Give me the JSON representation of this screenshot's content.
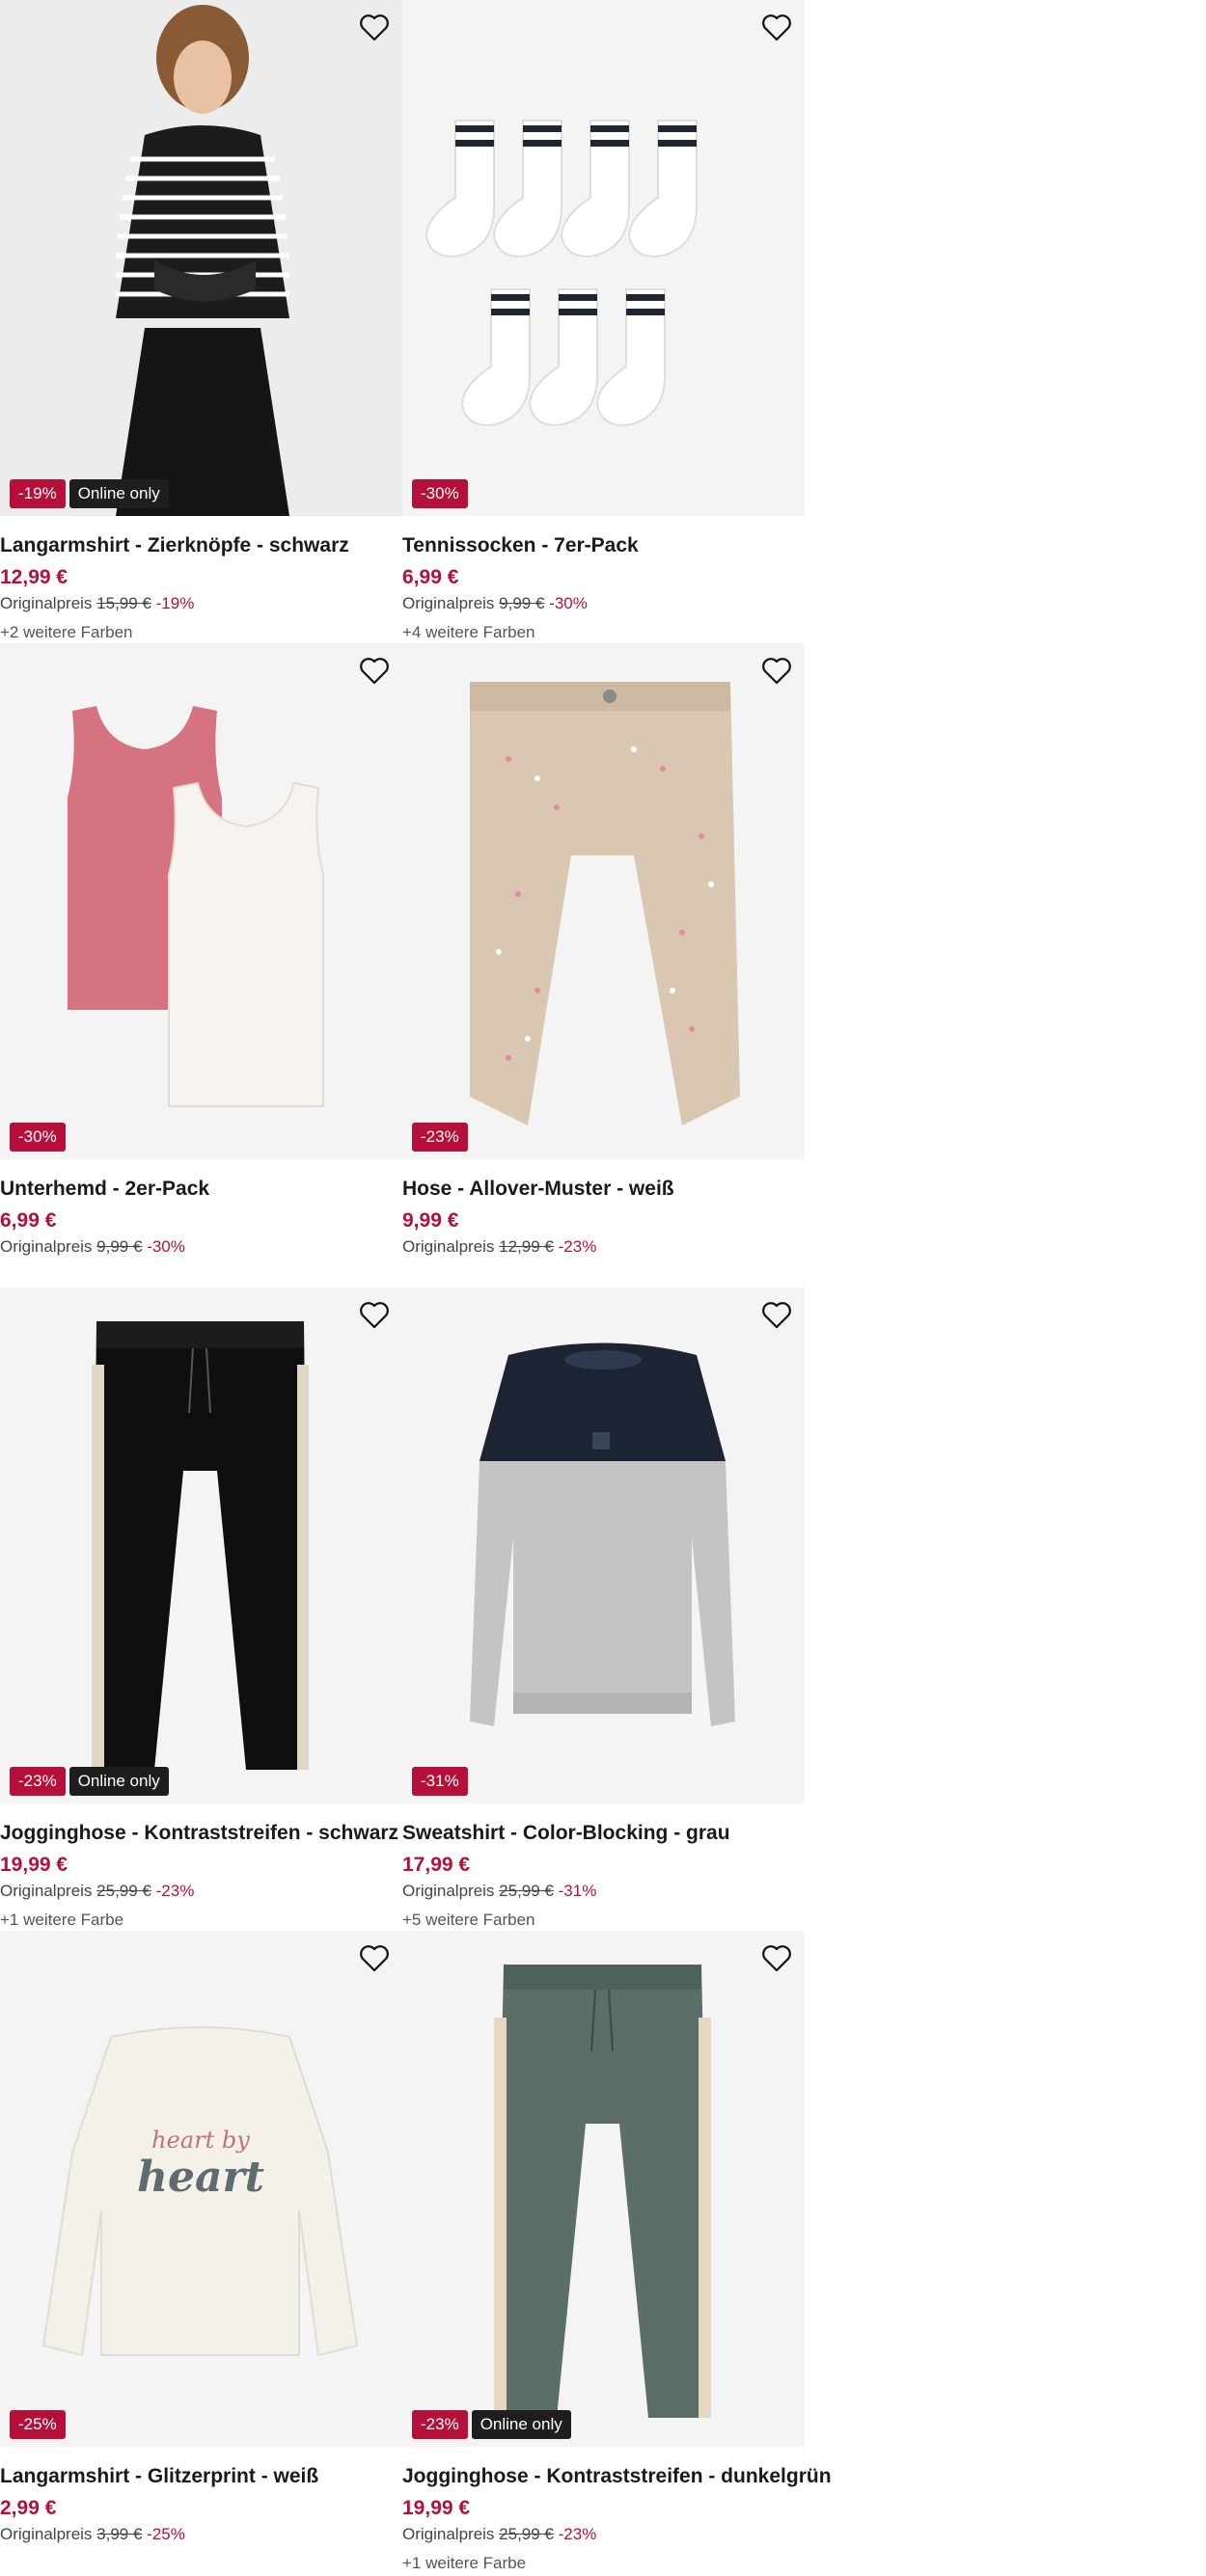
{
  "colors": {
    "sale": "#b5103a",
    "online": "#1e1e1e",
    "price": "#b5103a"
  },
  "products": [
    {
      "title": "Langarmshirt - Zierknöpfe - schwarz",
      "price": "12,99 €",
      "orig_label": "Originalpreis",
      "orig_price": "15,99 €",
      "discount": "-19%",
      "badge_sale": "-19%",
      "badge_online": "Online only",
      "more_colors": "+2 weitere Farben",
      "image_icon": "striped-longsleeve-model",
      "fav_icon": "heart-outline-icon"
    },
    {
      "title": "Tennissocken - 7er-Pack",
      "price": "6,99 €",
      "orig_label": "Originalpreis",
      "orig_price": "9,99 €",
      "discount": "-30%",
      "badge_sale": "-30%",
      "badge_online": "",
      "more_colors": "+4 weitere Farben",
      "image_icon": "white-tennis-socks",
      "fav_icon": "heart-outline-icon"
    },
    {
      "title": "Unterhemd - 2er-Pack",
      "price": "6,99 €",
      "orig_label": "Originalpreis",
      "orig_price": "9,99 €",
      "discount": "-30%",
      "badge_sale": "-30%",
      "badge_online": "",
      "more_colors": "",
      "image_icon": "tank-tops-pink-white",
      "fav_icon": "heart-outline-icon"
    },
    {
      "title": "Hose - Allover-Muster - weiß",
      "price": "9,99 €",
      "orig_label": "Originalpreis",
      "orig_price": "12,99 €",
      "discount": "-23%",
      "badge_sale": "-23%",
      "badge_online": "",
      "more_colors": "",
      "image_icon": "beige-patterned-pants",
      "fav_icon": "heart-outline-icon"
    },
    {
      "title": "Jogginghose - Kontraststreifen - schwarz",
      "price": "19,99 €",
      "orig_label": "Originalpreis",
      "orig_price": "25,99 €",
      "discount": "-23%",
      "badge_sale": "-23%",
      "badge_online": "Online only",
      "more_colors": "+1 weitere Farbe",
      "image_icon": "black-jogging-pants",
      "fav_icon": "heart-outline-icon"
    },
    {
      "title": "Sweatshirt - Color-Blocking - grau",
      "price": "17,99 €",
      "orig_label": "Originalpreis",
      "orig_price": "25,99 €",
      "discount": "-31%",
      "badge_sale": "-31%",
      "badge_online": "",
      "more_colors": "+5 weitere Farben",
      "image_icon": "grey-navy-sweatshirt",
      "fav_icon": "heart-outline-icon"
    },
    {
      "title": "Langarmshirt - Glitzerprint - weiß",
      "price": "2,99 €",
      "orig_label": "Originalpreis",
      "orig_price": "3,99 €",
      "discount": "-25%",
      "badge_sale": "-25%",
      "badge_online": "",
      "more_colors": "",
      "image_icon": "white-heart-print-shirt",
      "image_text_1": "heart by",
      "image_text_2": "heart",
      "fav_icon": "heart-outline-icon"
    },
    {
      "title": "Jogginghose - Kontraststreifen - dunkelgrün",
      "price": "19,99 €",
      "orig_label": "Originalpreis",
      "orig_price": "25,99 €",
      "discount": "-23%",
      "badge_sale": "-23%",
      "badge_online": "Online only",
      "more_colors": "+1 weitere Farbe",
      "image_icon": "green-jogging-pants",
      "fav_icon": "heart-outline-icon"
    }
  ]
}
